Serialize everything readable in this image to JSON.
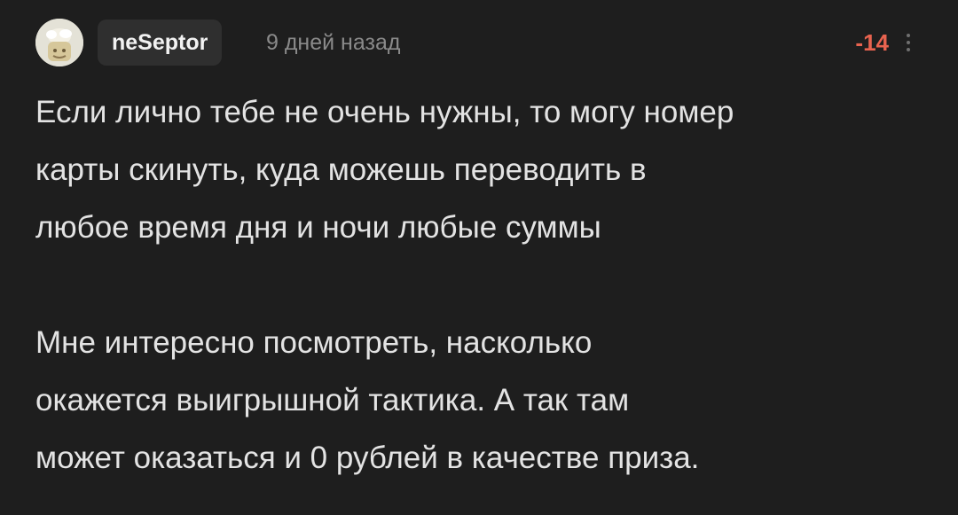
{
  "comment": {
    "author": "neSeptor",
    "timestamp": "9 дней назад",
    "rating": "-14",
    "avatar_icon": "avatar-icon",
    "more_icon": "more-vertical-icon",
    "paragraphs": [
      "Если лично тебе не очень нужны, то могу номер\nкарты скинуть, куда можешь переводить в\nлюбое время дня и ночи любые суммы",
      "Мне интересно посмотреть, насколько\nокажется выигрышной тактика. А так там\nможет оказаться и 0 рублей в качестве приза."
    ]
  },
  "colors": {
    "background": "#1e1e1e",
    "text": "#e3e3e3",
    "timestamp": "#8a8a8a",
    "rating_negative": "#e8634f",
    "username_pill": "#2f2f2f"
  }
}
